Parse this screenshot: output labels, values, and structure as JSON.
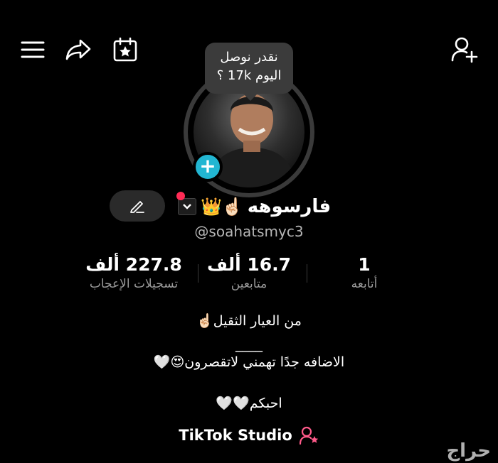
{
  "topbar": {
    "menu_icon": "menu-icon",
    "share_icon": "share-icon",
    "calendar_icon": "calendar-star-icon",
    "add_friend_icon": "add-user-icon"
  },
  "profile": {
    "story_note": "نقدر نوصل اليوم 17k ؟",
    "display_name": "فارسوهه",
    "name_emojis": "👑☝🏻",
    "username": "@soahatsmyc3"
  },
  "stats": [
    {
      "value": "1",
      "label": "أتابعه"
    },
    {
      "value": "16.7 ألف",
      "label": "متابعين"
    },
    {
      "value": "227.8 ألف",
      "label": "تسجيلات الإعجاب"
    }
  ],
  "bio": {
    "line1": "من العيار الثقيل☝🏻",
    "line2": "____",
    "line3": "الاضافه جدًا تهمني لاتقصرون😍🤍",
    "line4": "احبكم🤍🤍"
  },
  "studio": {
    "label": "TikTok Studio"
  },
  "watermark": "حراج",
  "colors": {
    "accent_cyan": "#22b6d2",
    "notify_red": "#ff2b55",
    "studio_pink": "#ff5a8a"
  }
}
